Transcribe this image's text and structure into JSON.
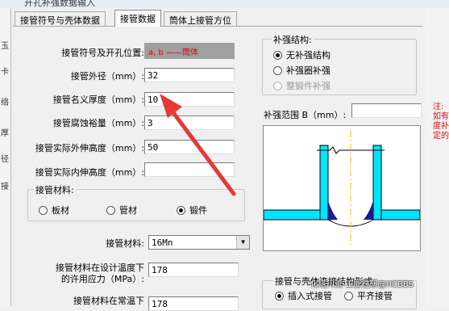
{
  "window": {
    "title": "开孔补强数据输入"
  },
  "left_strip": [
    "玉",
    "卡",
    "络",
    "厚",
    "径",
    "接"
  ],
  "right_strip": [
    "注:",
    "如有",
    "度补",
    "定的"
  ],
  "tabs": [
    {
      "label": "接管符号与壳体数据",
      "active": false
    },
    {
      "label": "接管数据",
      "active": true
    },
    {
      "label": "筒体上接管方位",
      "active": false
    }
  ],
  "form": {
    "symbol_label": "接管符号及开孔位置:",
    "symbol_value": "a, b ——筒体",
    "od_label": "接管外径（mm）:",
    "od_value": "32",
    "thickness_label": "接管名义厚度（mm）:",
    "thickness_value": "10",
    "corrosion_label": "接管腐蚀裕量（mm）:",
    "corrosion_value": "3",
    "ext_height_label": "接管实际外伸高度（mm）:",
    "ext_height_value": "50",
    "int_height_label": "接管实际内伸高度（mm）:",
    "int_height_value": ""
  },
  "material_group": {
    "title": "接管材料:",
    "options": [
      {
        "label": "板材",
        "selected": false
      },
      {
        "label": "管材",
        "selected": false
      },
      {
        "label": "锻件",
        "selected": true
      }
    ]
  },
  "material_select": {
    "label": "接管材料:",
    "value": "16Mn"
  },
  "stress": {
    "design_label_1": "接管材料在设计温度下",
    "design_label_2": "的许用应力（MPa）:",
    "design_value": "178",
    "room_label": "接管材料在常温下",
    "room_value": "178"
  },
  "reinforcement": {
    "title": "补强结构:",
    "options": [
      {
        "label": "无补强结构",
        "selected": true,
        "disabled": false
      },
      {
        "label": "补强圈补强",
        "selected": false,
        "disabled": false
      },
      {
        "label": "整锻件补强",
        "selected": false,
        "disabled": true
      }
    ]
  },
  "range": {
    "label": "补强范围 B（mm）:",
    "value": ""
  },
  "connection": {
    "title": "接管与壳体连接结构形式:",
    "options": [
      {
        "label": "插入式接管",
        "selected": true
      },
      {
        "label": "平齐接管",
        "selected": false
      }
    ]
  },
  "colors": {
    "pipe": "#00e5ff",
    "weld": "#1a1a8a",
    "annotation": "#e53935",
    "centerline": "#f0c000"
  },
  "watermark": "化塔川流-工业往研@HCBBS"
}
